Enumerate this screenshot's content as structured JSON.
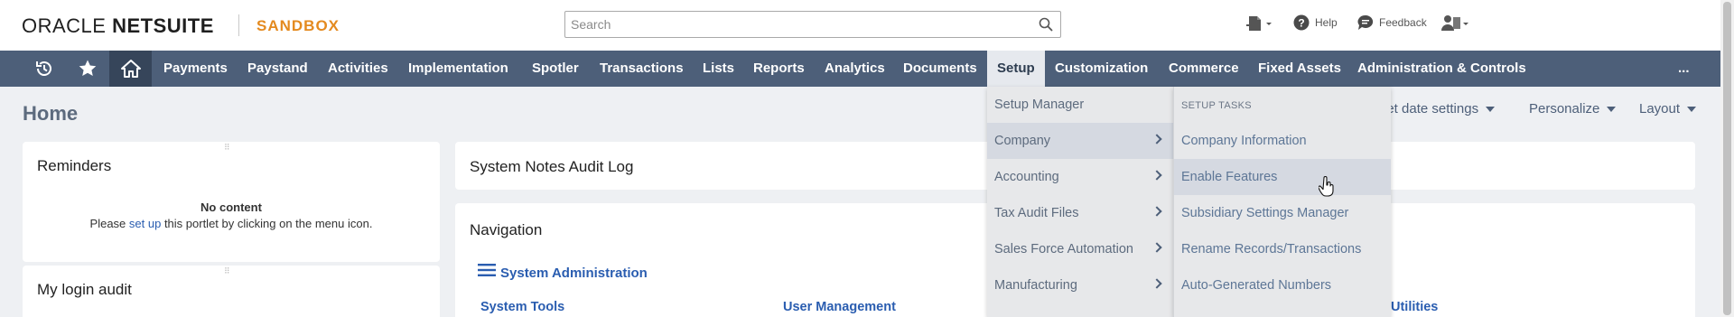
{
  "header": {
    "logo_part1": "ORACLE ",
    "logo_part2": "NETSUITE",
    "environment": "SANDBOX",
    "search_placeholder": "Search",
    "help_label": "Help",
    "feedback_label": "Feedback"
  },
  "nav": {
    "items": [
      {
        "label": "Payments"
      },
      {
        "label": "Paystand"
      },
      {
        "label": "Activities"
      },
      {
        "label": "Implementation"
      },
      {
        "label": "Spotler"
      },
      {
        "label": "Transactions"
      },
      {
        "label": "Lists"
      },
      {
        "label": "Reports"
      },
      {
        "label": "Analytics"
      },
      {
        "label": "Documents"
      },
      {
        "label": "Setup"
      },
      {
        "label": "Customization"
      },
      {
        "label": "Commerce"
      },
      {
        "label": "Fixed Assets"
      },
      {
        "label": "Administration & Controls"
      }
    ],
    "more_label": "..."
  },
  "page": {
    "title": "Home",
    "portlet_date_settings": "let date settings",
    "personalize": "Personalize",
    "layout": "Layout"
  },
  "reminders": {
    "title": "Reminders",
    "no_content": "No content",
    "please": "Please ",
    "set_up": "set up",
    "rest": " this portlet by clicking on the menu icon."
  },
  "login_audit": {
    "title": "My login audit"
  },
  "system_notes": {
    "title": "System Notes Audit Log"
  },
  "navigation": {
    "title": "Navigation",
    "section": "System Administration",
    "col1": "System Tools",
    "col2": "User Management",
    "col3": "Utilities"
  },
  "setup_menu": {
    "items": [
      {
        "label": "Setup Manager",
        "has_submenu": false
      },
      {
        "label": "Company",
        "has_submenu": true
      },
      {
        "label": "Accounting",
        "has_submenu": true
      },
      {
        "label": "Tax Audit Files",
        "has_submenu": true
      },
      {
        "label": "Sales Force Automation",
        "has_submenu": true
      },
      {
        "label": "Manufacturing",
        "has_submenu": true
      }
    ]
  },
  "company_submenu": {
    "heading": "SETUP TASKS",
    "items": [
      {
        "label": "Company Information"
      },
      {
        "label": "Enable Features"
      },
      {
        "label": "Subsidiary Settings Manager"
      },
      {
        "label": "Rename Records/Transactions"
      },
      {
        "label": "Auto-Generated Numbers"
      }
    ]
  },
  "colors": {
    "nav_bg": "#4d5f79",
    "home_bg": "#36455a",
    "sandbox": "#e48a1f",
    "link": "#2a5db0"
  }
}
